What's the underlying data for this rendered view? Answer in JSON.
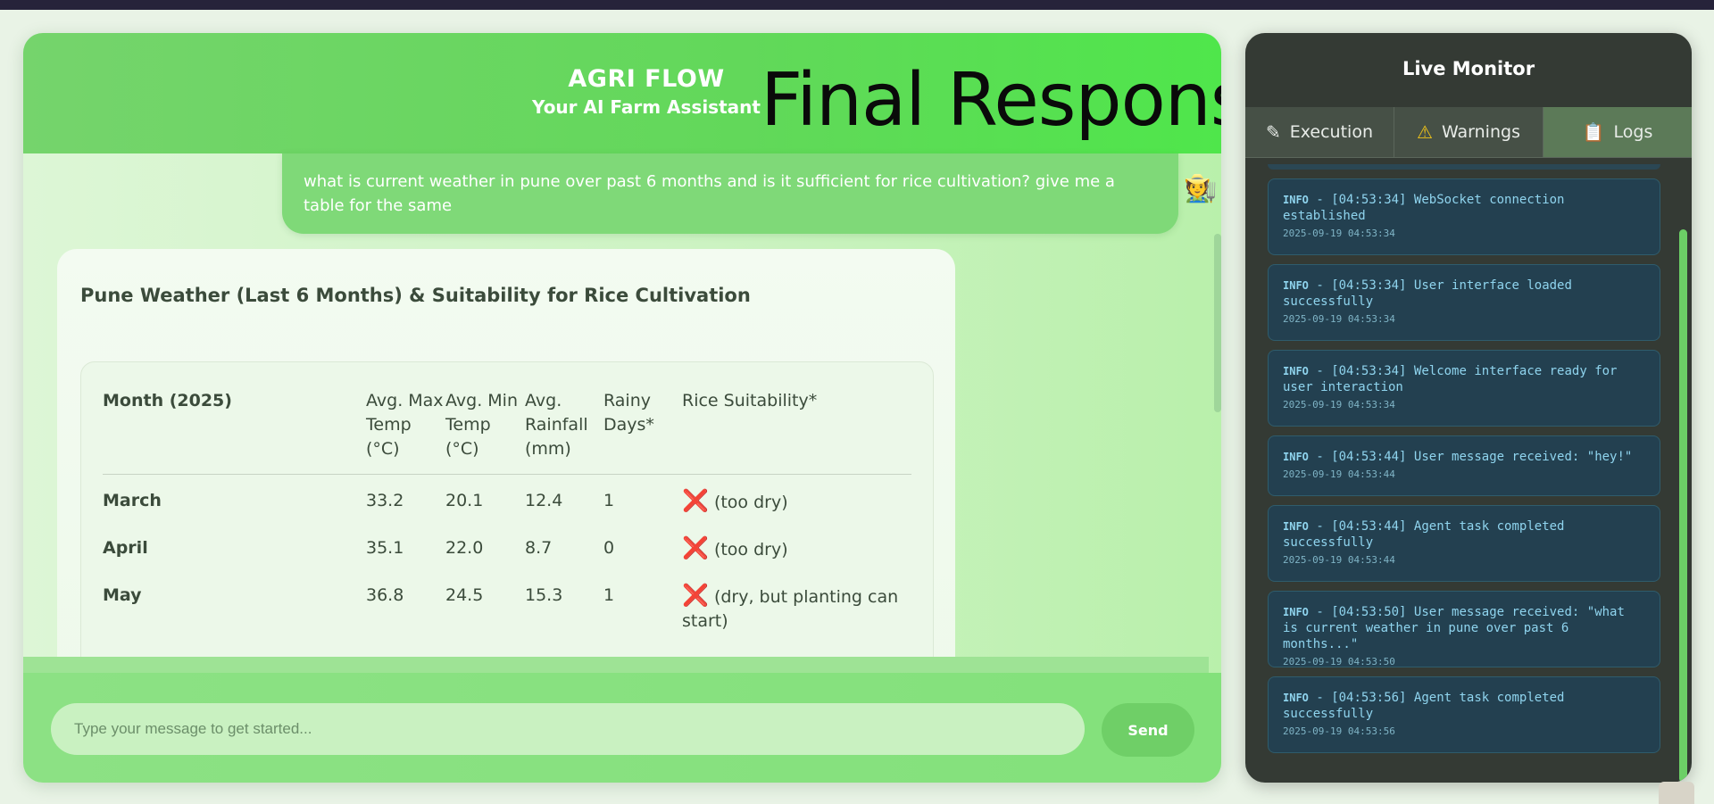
{
  "header": {
    "brand_title": "AGRI FLOW",
    "brand_subtitle": "Your AI Farm Assistant",
    "overlay_title": "Final Response"
  },
  "chat": {
    "user_message": "what is current weather in pune over past 6 months and is it sufficient for rice cultivation? give me a table for the same",
    "user_avatar": "🧑‍🌾",
    "response_title": "Pune Weather (Last 6 Months) & Suitability for Rice Cultivation",
    "table": {
      "headers": [
        "Month (2025)",
        "Avg. Max Temp (°C)",
        "Avg. Min Temp (°C)",
        "Avg. Rainfall (mm)",
        "Rainy Days*",
        "Rice Suitability*"
      ],
      "rows": [
        {
          "month": "March",
          "max": "33.2",
          "min": "20.1",
          "rain": "12.4",
          "days": "1",
          "suit_icon": "❌",
          "suit": "(too dry)"
        },
        {
          "month": "April",
          "max": "35.1",
          "min": "22.0",
          "rain": "8.7",
          "days": "0",
          "suit_icon": "❌",
          "suit": "(too dry)"
        },
        {
          "month": "May",
          "max": "36.8",
          "min": "24.5",
          "rain": "15.3",
          "days": "1",
          "suit_icon": "❌",
          "suit": "(dry, but planting can start)"
        }
      ]
    }
  },
  "input": {
    "placeholder": "Type your message to get started...",
    "send_label": "Send"
  },
  "monitor": {
    "title": "Live Monitor",
    "tabs": [
      {
        "icon": "✎",
        "label": "Execution"
      },
      {
        "icon": "⚠",
        "label": "Warnings"
      },
      {
        "icon": "📋",
        "label": "Logs"
      }
    ],
    "logs": [
      {
        "level": "INFO",
        "message": " - [04:53:34] WebSocket connection established",
        "time": "2025-09-19 04:53:34"
      },
      {
        "level": "INFO",
        "message": " - [04:53:34] User interface loaded successfully",
        "time": "2025-09-19 04:53:34"
      },
      {
        "level": "INFO",
        "message": " - [04:53:34] Welcome interface ready for user interaction",
        "time": "2025-09-19 04:53:34"
      },
      {
        "level": "INFO",
        "message": " - [04:53:44] User message received: \"hey!\"",
        "time": "2025-09-19 04:53:44"
      },
      {
        "level": "INFO",
        "message": " - [04:53:44] Agent task completed successfully",
        "time": "2025-09-19 04:53:44"
      },
      {
        "level": "INFO",
        "message": " - [04:53:50] User message received: \"what is current weather in pune over past 6 months...\"",
        "time": "2025-09-19 04:53:50"
      },
      {
        "level": "INFO",
        "message": " - [04:53:56] Agent task completed successfully",
        "time": "2025-09-19 04:53:56"
      }
    ]
  },
  "colors": {
    "header_green": "#62d85a",
    "bubble_green": "#7fd978",
    "monitor_bg": "#343a34",
    "log_bg": "#234050",
    "log_text": "#8fd4ee",
    "cross_red": "#d21b1b"
  }
}
